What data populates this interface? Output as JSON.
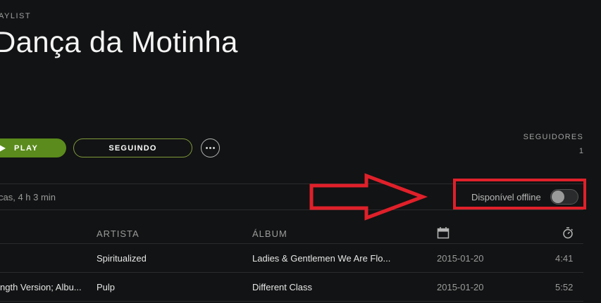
{
  "header": {
    "type_label": "AYLIST",
    "title": "Dança da Motinha"
  },
  "actions": {
    "play_label": "PLAY",
    "follow_label": "SEGUINDO",
    "more_icon": "more-dots-icon"
  },
  "followers": {
    "label": "SEGUIDORES",
    "count": "1"
  },
  "summary": {
    "text": "cas, 4 h 3 min",
    "offline_label": "Disponível offline",
    "offline_enabled": false
  },
  "annotation": {
    "color": "#e0202a"
  },
  "table": {
    "columns": {
      "artist": "ARTISTA",
      "album": "ÁLBUM",
      "date_icon": "calendar-icon",
      "duration_icon": "stopwatch-icon"
    },
    "rows": [
      {
        "title": "",
        "artist": "Spiritualized",
        "album": "Ladies & Gentlemen We Are Flo...",
        "date": "2015-01-20",
        "duration": "4:41"
      },
      {
        "title": "ngth Version; Albu...",
        "artist": "Pulp",
        "album": "Different Class",
        "date": "2015-01-20",
        "duration": "5:52"
      }
    ]
  },
  "colors": {
    "background": "#121314",
    "play_green": "#5a8b1c",
    "annotation_red": "#e0202a"
  }
}
